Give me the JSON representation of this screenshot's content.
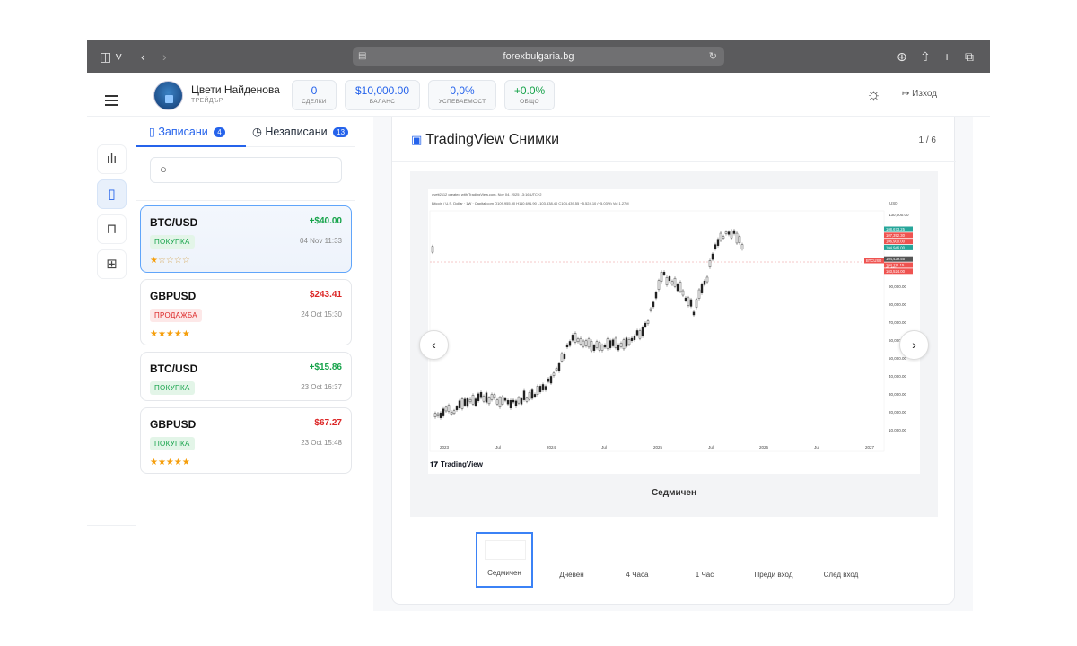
{
  "browser": {
    "url": "forexbulgaria.bg"
  },
  "user": {
    "name": "Цвети Найденова",
    "role": "ТРЕЙДЪР"
  },
  "stats": [
    {
      "value": "0",
      "label": "СДЕЛКИ"
    },
    {
      "value": "$10,000.00",
      "label": "БАЛАНС"
    },
    {
      "value": "0,0%",
      "label": "УСПЕВАЕМОСТ"
    },
    {
      "value": "+0.0%",
      "label": "ОБЩО"
    }
  ],
  "header": {
    "logout": "Изход"
  },
  "tabs": [
    {
      "label": "Записани",
      "count": "4"
    },
    {
      "label": "Незаписани",
      "count": "13"
    }
  ],
  "trades": [
    {
      "pair": "BTC/USD",
      "pnl": "+$40.00",
      "side": "ПОКУПКА",
      "date": "04 Nov 11:33",
      "rating": 1
    },
    {
      "pair": "GBPUSD",
      "pnl": "$243.41",
      "side": "ПРОДАЖБА",
      "date": "24 Oct 15:30",
      "rating": 5
    },
    {
      "pair": "BTC/USD",
      "pnl": "+$15.86",
      "side": "ПОКУПКА",
      "date": "23 Oct 16:37",
      "rating": 5
    },
    {
      "pair": "GBPUSD",
      "pnl": "$67.27",
      "side": "ПОКУПКА",
      "date": "23 Oct 15:48",
      "rating": 5
    }
  ],
  "panel": {
    "title": "TradingView Снимки",
    "counter": "1 / 6",
    "caption": "Седмичен"
  },
  "thumbnails": [
    "Седмичен",
    "Дневен",
    "4 Часа",
    "1 Час",
    "Преди вход",
    "След вход"
  ],
  "colors": {
    "accent": "#2563eb",
    "positive": "#16a34a",
    "negative": "#dc2626",
    "star": "#f59e0b"
  },
  "snapshot": {
    "header_line": "ovett2112 created with TradingView.com, Nov 04, 2025 13:16 UTC+2",
    "symbol_line": "Bitcoin / U.S. Dollar · 1W · Capital.com  O109,955.90 H110,691.90 L103,538.40 C104,439.55 −5,524.10 (−5.03%) Vol 1.27M",
    "currency": "USD",
    "brand": "TradingView",
    "y_ticks": [
      "130,000.00",
      "90,000.00",
      "80,000.00",
      "70,000.00",
      "60,000.00",
      "50,000.00",
      "40,000.00",
      "30,000.00",
      "20,000.00",
      "10,000.00"
    ],
    "x_ticks": [
      "2023",
      "Jul",
      "2024",
      "Jul",
      "2025",
      "Jul",
      "2026",
      "Jul",
      "2027"
    ],
    "price_tags": [
      "108,673.25",
      "107,392.30",
      "106,900.00",
      "104,946.00",
      "104,439.55",
      "104,111.15",
      "103,524.00"
    ],
    "current_label": "BTCUSD",
    "countdown": "3d 11h"
  }
}
